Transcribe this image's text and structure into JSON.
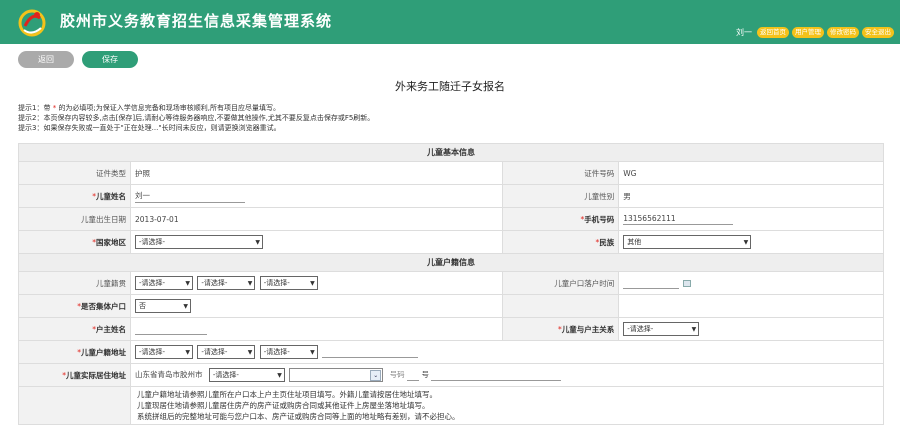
{
  "header": {
    "title": "胶州市义务教育招生信息采集管理系统",
    "user": "刘一",
    "nav": [
      "返回首页",
      "用户管理",
      "修改密码",
      "安全退出"
    ]
  },
  "toolbar": {
    "back": "返回",
    "save": "保存"
  },
  "page_title": "外来务工随迁子女报名",
  "tips": {
    "line1_a": "提示1：带",
    "line1_star": "*",
    "line1_b": "的为必填项;为保证入学信息完备和现场审核顺利,所有项目应尽量填写。",
    "line2": "提示2：本页保存内容较多,点击[保存]后,请耐心等待服务器响应,不要做其他操作,尤其不要反复点击保存或F5刷新。",
    "line3": "提示3：如果保存失败或一直处于\"正在处理...\"长时间未反应，则请更换浏览器重试。"
  },
  "star": "*",
  "basic": {
    "section": "儿童基本信息",
    "id_type_label": "证件类型",
    "id_type_value": "护照",
    "id_no_label": "证件号码",
    "id_no_value": "WG",
    "name_label": "儿童姓名",
    "name_value": "刘一",
    "gender_label": "儿童性别",
    "gender_value": "男",
    "birth_label": "儿童出生日期",
    "birth_value": "2013-07-01",
    "phone_label": "手机号码",
    "phone_value": "13156562111",
    "country_label": "国家地区",
    "country_value": "-请选择-",
    "ethnic_label": "民族",
    "ethnic_value": "其他"
  },
  "household": {
    "section": "儿童户籍信息",
    "origin_label": "儿童籍贯",
    "origin_values": [
      "-请选择-",
      "-请选择-",
      "-请选择-"
    ],
    "reg_time_label": "儿童户口落户时间",
    "collective_label": "是否集体户口",
    "collective_value": "否",
    "head_label": "户主姓名",
    "relation_label": "儿童与户主关系",
    "relation_value": "-请选择-",
    "reg_addr_label": "儿童户籍地址",
    "reg_addr_values": [
      "-请选择-",
      "-请选择-",
      "-请选择-"
    ],
    "live_addr_label": "儿童实际居住地址",
    "live_addr_prefix": "山东省青岛市胶州市",
    "live_addr_select": "-请选择-",
    "number_hint": "号码",
    "number_suffix": "号",
    "notes": [
      "儿童户籍地址请参照儿童所在户口本上户主页住址项目填写。外籍儿童请按居住地址填写。",
      "儿童现居住地请参照儿童居住房产的房产证或购房合同或其他证件上房屋坐落地址填写。",
      "系统拼组后的完整地址可能与您户口本、房产证或购房合同等上面的地址略有差别，请不必担心。"
    ]
  }
}
